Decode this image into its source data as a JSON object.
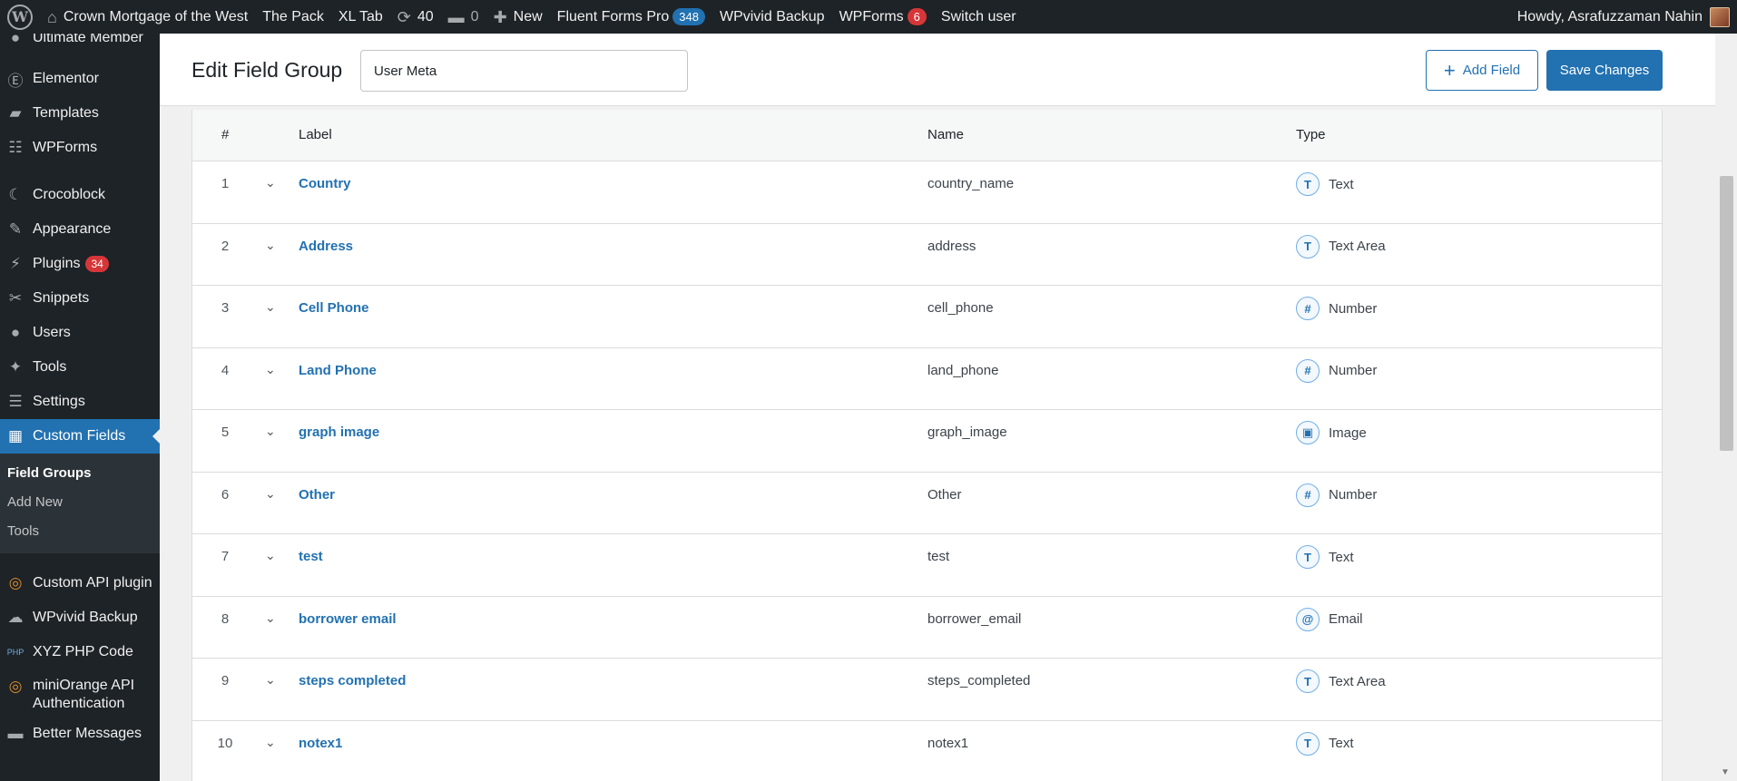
{
  "adminbar": {
    "site_name": "Crown Mortgage of the West",
    "the_pack": "The Pack",
    "xl_tab": "XL Tab",
    "updates_count": "40",
    "comments_count": "0",
    "new_label": "New",
    "fluent_forms": "Fluent Forms Pro",
    "fluent_count": "348",
    "wpvivid": "WPvivid Backup",
    "wpforms": "WPForms",
    "wpforms_count": "6",
    "switch_user": "Switch user",
    "howdy": "Howdy, Asrafuzzaman Nahin"
  },
  "sidebar": {
    "items": [
      {
        "label": "Ultimate Member",
        "icon": "user-icon"
      },
      {
        "label": "Elementor",
        "icon": "elementor-icon"
      },
      {
        "label": "Templates",
        "icon": "folder-icon"
      },
      {
        "label": "WPForms",
        "icon": "form-icon"
      },
      {
        "label": "Crocoblock",
        "icon": "crocoblock-icon"
      },
      {
        "label": "Appearance",
        "icon": "brush-icon"
      },
      {
        "label": "Plugins",
        "icon": "plugin-icon",
        "badge": "34"
      },
      {
        "label": "Snippets",
        "icon": "scissors-icon"
      },
      {
        "label": "Users",
        "icon": "users-icon"
      },
      {
        "label": "Tools",
        "icon": "wrench-icon"
      },
      {
        "label": "Settings",
        "icon": "settings-icon"
      },
      {
        "label": "Custom Fields",
        "icon": "custom-fields-icon"
      }
    ],
    "submenu": [
      "Field Groups",
      "Add New",
      "Tools"
    ],
    "after": [
      {
        "label": "Custom API plugin",
        "icon": "api-icon"
      },
      {
        "label": "WPvivid Backup",
        "icon": "cloud-icon"
      },
      {
        "label": "XYZ PHP Code",
        "icon": "php-icon"
      },
      {
        "label": "miniOrange API Authentication",
        "icon": "api-icon"
      },
      {
        "label": "Better Messages",
        "icon": "messages-icon"
      }
    ]
  },
  "header": {
    "title": "Edit Field Group",
    "group_name": "User Meta",
    "add_field": "Add Field",
    "save_changes": "Save Changes"
  },
  "table": {
    "columns": {
      "num": "#",
      "label": "Label",
      "name": "Name",
      "type": "Type"
    },
    "rows": [
      {
        "num": "1",
        "label": "Country",
        "name": "country_name",
        "type": "Text",
        "type_icon": "T"
      },
      {
        "num": "2",
        "label": "Address",
        "name": "address",
        "type": "Text Area",
        "type_icon": "T"
      },
      {
        "num": "3",
        "label": "Cell Phone",
        "name": "cell_phone",
        "type": "Number",
        "type_icon": "#"
      },
      {
        "num": "4",
        "label": "Land Phone",
        "name": "land_phone",
        "type": "Number",
        "type_icon": "#"
      },
      {
        "num": "5",
        "label": "graph image",
        "name": "graph_image",
        "type": "Image",
        "type_icon": "▣"
      },
      {
        "num": "6",
        "label": "Other",
        "name": "Other",
        "type": "Number",
        "type_icon": "#"
      },
      {
        "num": "7",
        "label": "test",
        "name": "test",
        "type": "Text",
        "type_icon": "T"
      },
      {
        "num": "8",
        "label": "borrower email",
        "name": "borrower_email",
        "type": "Email",
        "type_icon": "@"
      },
      {
        "num": "9",
        "label": "steps completed",
        "name": "steps_completed",
        "type": "Text Area",
        "type_icon": "T"
      },
      {
        "num": "10",
        "label": "notex1",
        "name": "notex1",
        "type": "Text",
        "type_icon": "T"
      }
    ]
  },
  "colors": {
    "accent": "#2271b1",
    "adminbar": "#1d2327",
    "badge": "#d63638"
  }
}
